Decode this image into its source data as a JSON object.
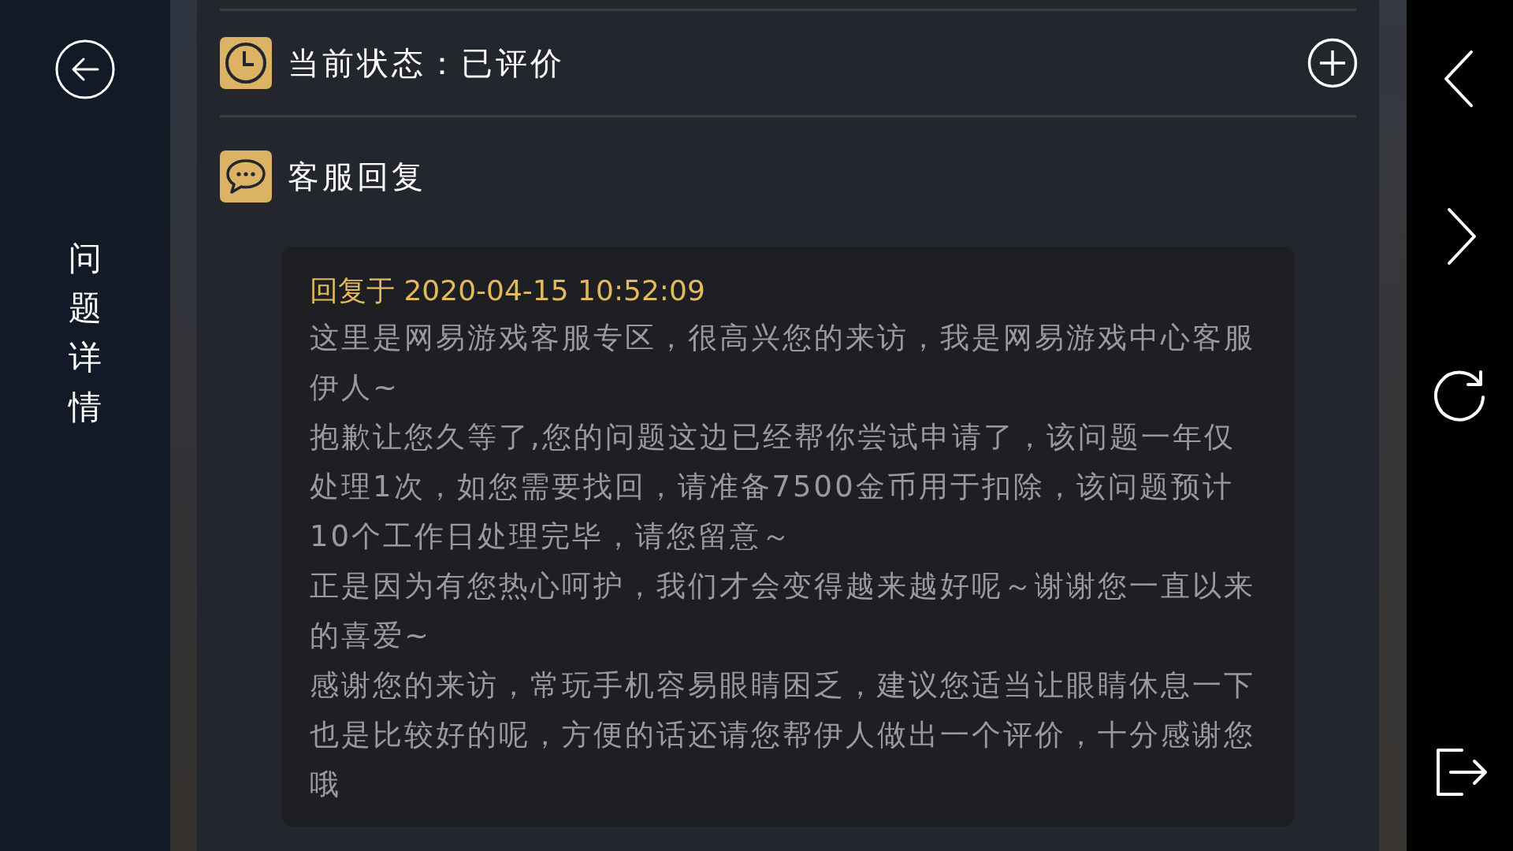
{
  "sidebar": {
    "title": "问题详情"
  },
  "status": {
    "label": "当前状态：已评价"
  },
  "reply_section": {
    "heading": "客服回复",
    "reply": {
      "timestamp": "回复于 2020-04-15 10:52:09",
      "paragraphs": [
        "这里是网易游戏客服专区，很高兴您的来访，我是网易游戏中心客服伊人~",
        "抱歉让您久等了,您的问题这边已经帮你尝试申请了，该问题一年仅处理1次，如您需要找回，请准备7500金币用于扣除，该问题预计10个工作日处理完毕，请您留意～",
        "正是因为有您热心呵护，我们才会变得越来越好呢～谢谢您一直以来的喜爱~",
        "感谢您的来访，常玩手机容易眼睛困乏，建议您适当让眼睛休息一下也是比较好的呢，方便的话还请您帮伊人做出一个评价，十分感谢您哦"
      ]
    }
  }
}
